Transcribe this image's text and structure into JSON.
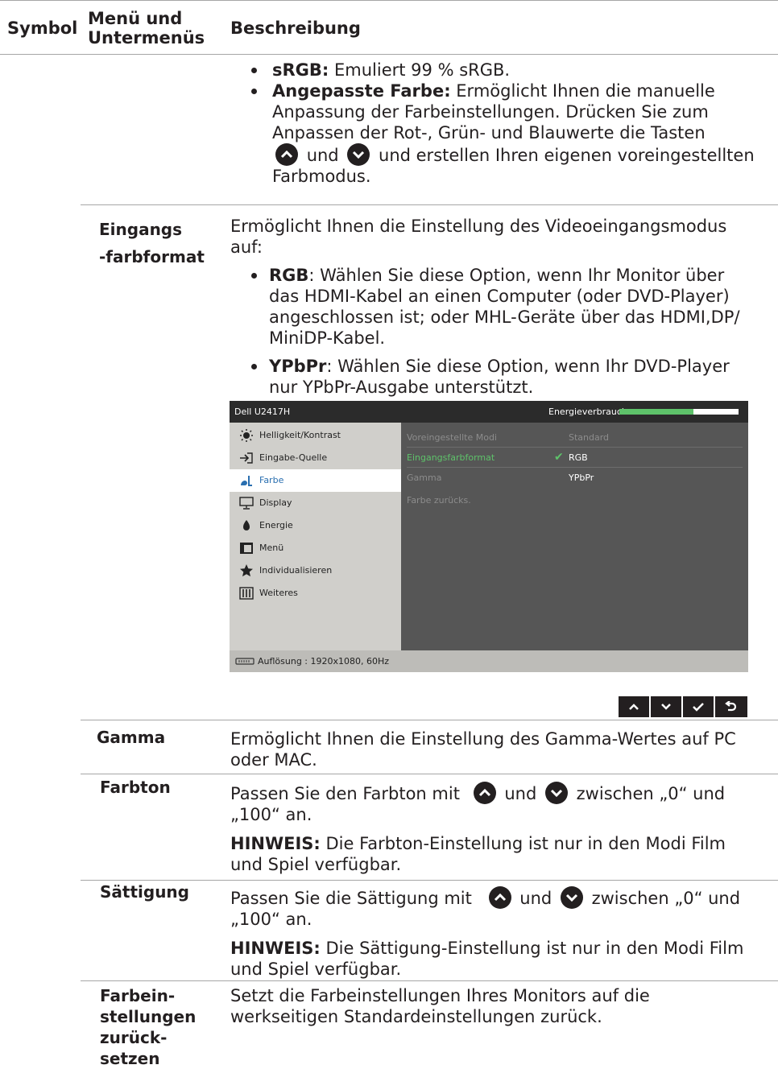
{
  "header": {
    "col_symbol": "Symbol",
    "col_menu_line1": "Menü und",
    "col_menu_line2": "Untermenüs",
    "col_desc": "Beschreibung"
  },
  "top_bullets": {
    "srgb_label": "sRGB:",
    "srgb_text": "Emuliert 99 % sRGB.",
    "custom_label": "Angepasste Farbe:",
    "custom_line1": "Ermöglicht Ihnen die manuelle",
    "custom_line2": "Anpassung der Farbeinstellungen. Drücken Sie zum",
    "custom_line3": "Anpassen der Rot-, Grün- und Blauwerte die Tasten",
    "custom_line4_mid": "und",
    "custom_line4_end": "und erstellen Ihren eigenen voreingestellten",
    "custom_line5": "Farbmodus."
  },
  "input_color": {
    "label_line1": "Eingangs",
    "label_line2": "-farbformat",
    "intro_line1": "Ermöglicht Ihnen die Einstellung des Videoeingangsmodus",
    "intro_line2": "auf:",
    "rgb_label": "RGB",
    "rgb_line1": ": Wählen Sie diese Option, wenn Ihr Monitor über",
    "rgb_line2": "das HDMI-Kabel an einen Computer (oder DVD-Player)",
    "rgb_line3": "angeschlossen ist; oder MHL-Geräte über das HDMI,DP/",
    "rgb_line4": "MiniDP-Kabel.",
    "ypbpr_label": "YPbPr",
    "ypbpr_line1": ": Wählen Sie diese Option, wenn Ihr DVD-Player",
    "ypbpr_line2": "nur YPbPr-Ausgabe unterstützt."
  },
  "osd": {
    "title": "Dell U2417H",
    "energy_label": "Energieverbrauch",
    "energy_level": 0.62,
    "sidebar": [
      {
        "label": "Helligkeit/Kontrast",
        "icon": "brightness-icon"
      },
      {
        "label": "Eingabe-Quelle",
        "icon": "input-source-icon"
      },
      {
        "label": "Farbe",
        "icon": "color-icon"
      },
      {
        "label": "Display",
        "icon": "display-icon"
      },
      {
        "label": "Energie",
        "icon": "energy-icon"
      },
      {
        "label": "Menü",
        "icon": "menu-icon"
      },
      {
        "label": "Individualisieren",
        "icon": "star-icon"
      },
      {
        "label": "Weiteres",
        "icon": "others-icon"
      }
    ],
    "rows": [
      {
        "label": "Voreingestellte Modi",
        "value": "Standard"
      },
      {
        "label": "Eingangsfarbformat",
        "value": "RGB"
      },
      {
        "label": "Gamma",
        "value": "YPbPr"
      },
      {
        "label": "Farbe zurücks.",
        "value": ""
      }
    ],
    "resolution": "Auflösung : 1920x1080, 60Hz",
    "accent": "#5ec26a"
  },
  "gamma": {
    "label": "Gamma",
    "line1": "Ermöglicht Ihnen die Einstellung des Gamma-Wertes auf PC",
    "line2": "oder MAC."
  },
  "hue": {
    "label": "Farbton",
    "line1_a": "Passen Sie den Farbton mit",
    "line1_b": "und",
    "line1_c": "zwischen „0“ und",
    "line2": "„100“ an.",
    "note_label": "HINWEIS:",
    "note_line1": "Die Farbton-Einstellung ist nur in den Modi Film",
    "note_line2": "und Spiel verfügbar."
  },
  "saturation": {
    "label": "Sättigung",
    "line1_a": "Passen Sie die Sättigung mit",
    "line1_b": "und",
    "line1_c": "zwischen „0“ und",
    "line2": "„100“ an.",
    "note_label": "HINWEIS:",
    "note_line1": "Die Sättigung-Einstellung ist nur in den Modi Film",
    "note_line2": "und Spiel verfügbar."
  },
  "reset": {
    "label_line1": "Farbein-",
    "label_line2": "stellungen",
    "label_line3": "zurück-",
    "label_line4": "setzen",
    "line1": "Setzt die Farbeinstellungen Ihres Monitors auf die",
    "line2": "werkseitigen Standardeinstellungen zurück."
  }
}
